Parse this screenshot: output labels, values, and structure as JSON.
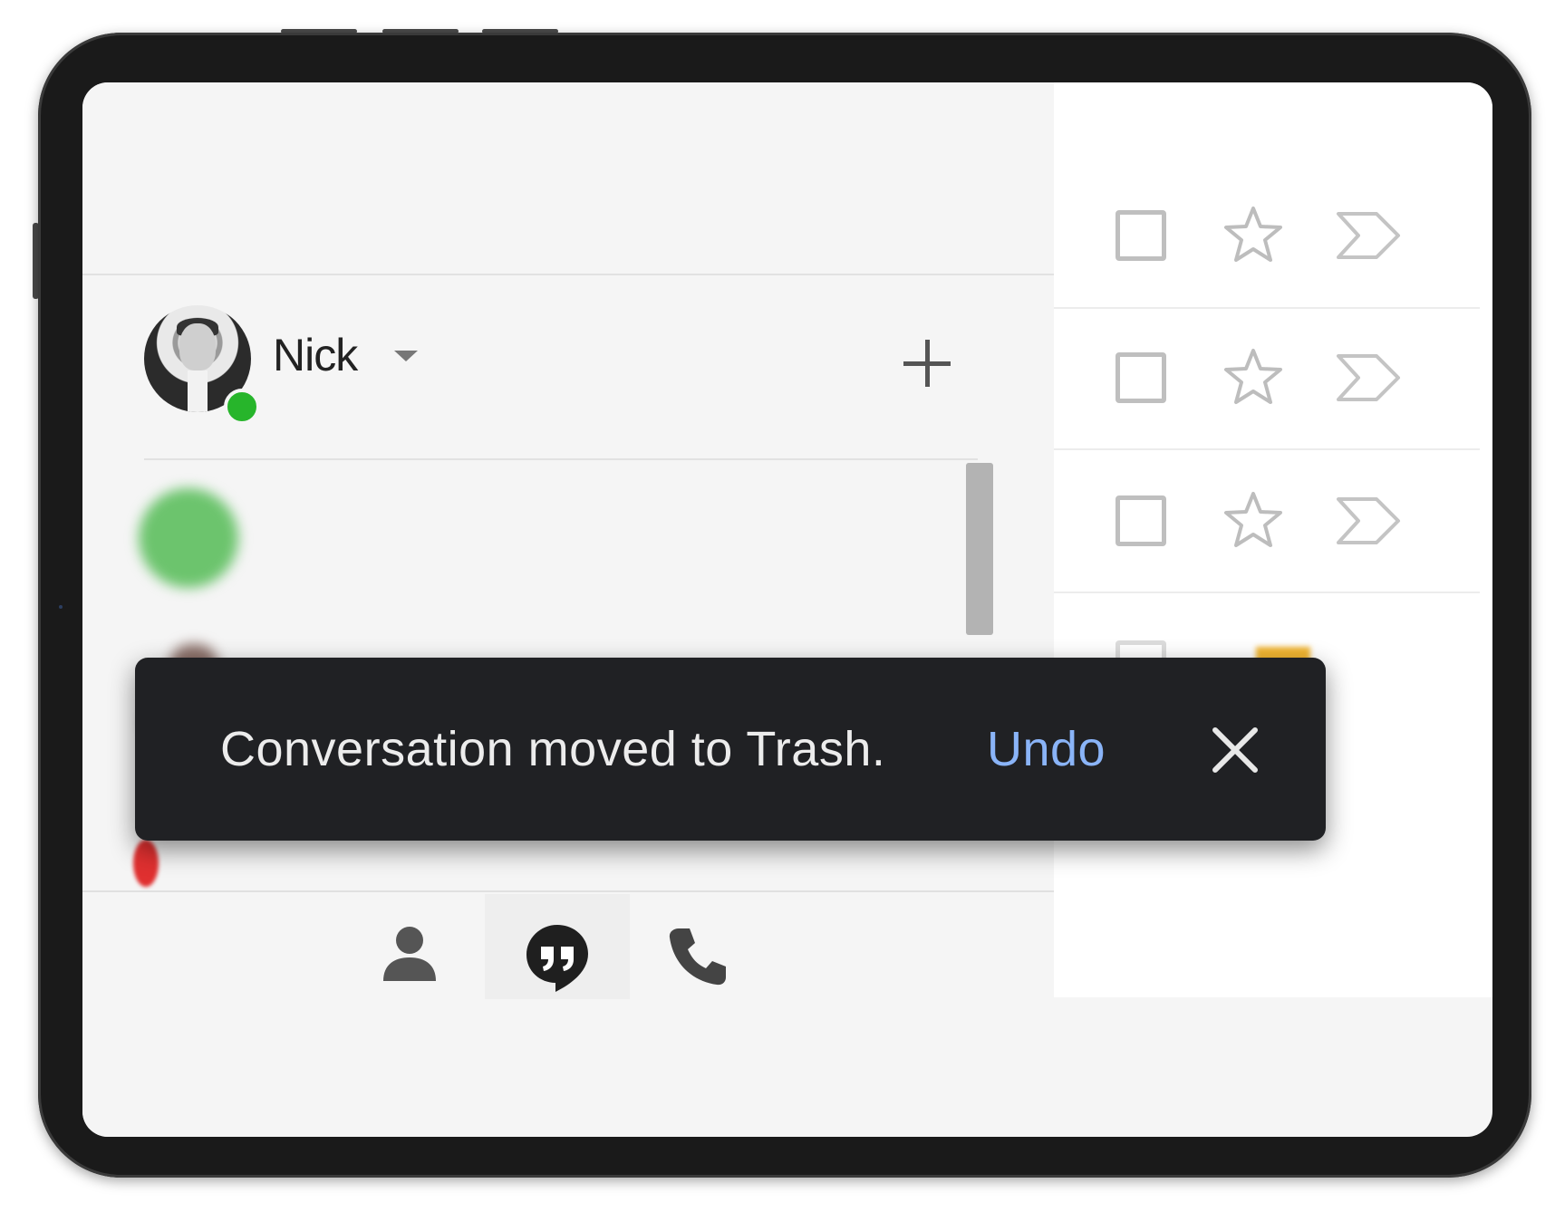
{
  "account": {
    "user_name": "Nick",
    "status": "online"
  },
  "conversations": [
    {
      "name": "",
      "preview": ""
    },
    {
      "name": "",
      "preview": ""
    }
  ],
  "bottom_nav": {
    "items": [
      {
        "icon": "person-icon",
        "active": false
      },
      {
        "icon": "hangouts-icon",
        "active": true
      },
      {
        "icon": "phone-icon",
        "active": false
      }
    ]
  },
  "mail_rows": [
    {
      "checkbox": "checkbox-icon",
      "star": "star-icon",
      "label": "label-icon"
    },
    {
      "checkbox": "checkbox-icon",
      "star": "star-icon",
      "label": "label-icon"
    },
    {
      "checkbox": "checkbox-icon",
      "star": "star-icon",
      "label": "label-icon"
    }
  ],
  "snackbar": {
    "message": "Conversation moved to Trash.",
    "action_label": "Undo",
    "close_icon": "close-icon"
  },
  "colors": {
    "snackbar_bg": "#202124",
    "undo_link": "#8ab4f8",
    "online_status": "#27b52b"
  }
}
